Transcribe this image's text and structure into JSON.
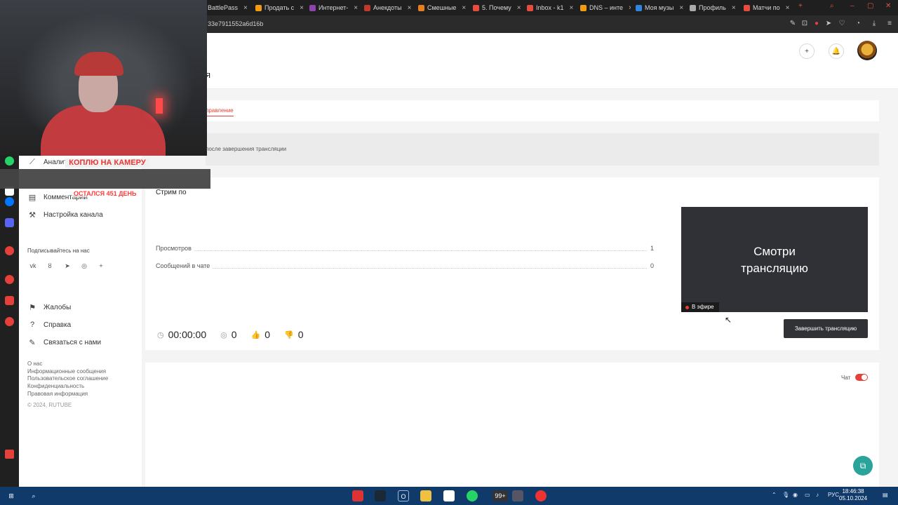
{
  "browser": {
    "tabs": [
      "BattlePass",
      "Продать с",
      "Интернет-",
      "Анекдоты",
      "Смешные",
      "5. Почему",
      "Inbox - k1",
      "DNS – инте",
      "Моя музы",
      "Профиль",
      "Матчи по"
    ],
    "url": "33e7911552a6d16b"
  },
  "header": {
    "title_fragment": "я",
    "tab_active": "правление",
    "notice": "после завершения трансляции"
  },
  "sidenav": {
    "items": [
      {
        "icon": "chart-icon",
        "label": "Аналитика"
      },
      {
        "icon": "comment-icon",
        "label": "Комментарии"
      },
      {
        "icon": "settings-icon",
        "label": "Настройка канала"
      }
    ],
    "follow_label": "Подписывайтесь на нас",
    "support": [
      {
        "icon": "flag-icon",
        "label": "Жалобы"
      },
      {
        "icon": "question-icon",
        "label": "Справка"
      },
      {
        "icon": "edit-icon",
        "label": "Связаться с нами"
      }
    ],
    "footer": [
      "О нас",
      "Информационные сообщения",
      "Пользовательское соглашение",
      "Конфиденциальность",
      "Правовая информация"
    ],
    "copyright": "© 2024, RUTUBE"
  },
  "stream": {
    "title": "Стрим по ",
    "views_label": "Просмотров",
    "views_value": "1",
    "chat_msgs_label": "Сообщений в чате",
    "chat_msgs_value": "0",
    "duration": "00:00:00",
    "viewers": "0",
    "likes": "0",
    "dislikes": "0",
    "preview_title_1": "Смотри",
    "preview_title_2": "трансляцию",
    "live_badge": "В эфире",
    "end_button": "Завершить трансляцию"
  },
  "chat": {
    "label": "Чат",
    "enabled": true
  },
  "overlay": {
    "banner_top": "КОПЛЮ НА КАМЕРУ",
    "banner_bottom": "ОСТАЛСЯ 451 ДЕНЬ"
  },
  "taskbar": {
    "badge": "99+",
    "lang": "РУС",
    "time": "18:46:38",
    "date": "05.10.2024"
  },
  "colors": {
    "accent": "#e5413a",
    "taskbar": "#0f3a6a",
    "help": "#2aa39a"
  }
}
